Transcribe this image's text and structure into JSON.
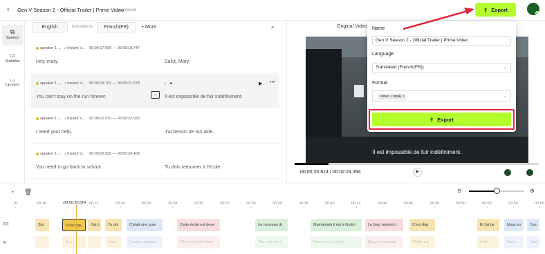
{
  "topbar": {
    "back_icon": "chevron-left-icon",
    "title": "Gen V Season 2 - Official Trailer | Prime Video",
    "saved": "Saved",
    "export_label": "Export",
    "help": "?"
  },
  "rail": {
    "items": [
      {
        "label": "Speech",
        "icon": "speech-icon"
      },
      {
        "label": "Subtitles",
        "icon": "subtitles-icon"
      },
      {
        "label": "Lip-sync",
        "icon": "lipsync-icon"
      }
    ]
  },
  "langbar": {
    "source": "English",
    "translate_to": "translate to",
    "target": "French(FR)",
    "more": "+ More"
  },
  "segments": [
    {
      "speaker": "speaker 1",
      "voice": "Instant V...",
      "start": "00:00:17.650",
      "end": "00:00:18.747",
      "src": "Hey, mary.",
      "tgt": "Salut, Mary."
    },
    {
      "speaker": "speaker 1",
      "voice": "Instant V...",
      "start": "00:00:19.701",
      "end": "00:00:21.578",
      "src": "You can't stay on the run forever.",
      "tgt": "Il est impossible de fuir indéfiniment."
    },
    {
      "speaker": "speaker 1",
      "voice": "Instant V...",
      "start": "00:00:21.570",
      "end": "00:00:22.920",
      "src": "I need your help.",
      "tgt": "J'ai besoin de ton aide."
    },
    {
      "speaker": "speaker 1",
      "voice": "Instant V...",
      "start": "00:00:22.920",
      "end": "00:00:24.409",
      "src": "You need to go back to school.",
      "tgt": "Tu dois retourner à l'école."
    }
  ],
  "preview": {
    "tab": "Original Video",
    "subtitle": "Il est impossible de fuir indéfiniment.",
    "time": "00:00:20.814 / 00:02:24.394",
    "progress": 0.14
  },
  "dialog": {
    "name_label": "Name",
    "name_value": "Gen V Season 2 - Official Trailer | Prime Video",
    "language_label": "Language",
    "language_value": "Translated (French(FR))",
    "format_label": "Format",
    "format_chip": "Video (.mp4)",
    "export_label": "Export"
  },
  "timeline": {
    "zoom": 0.5,
    "playhead_time": "00:00:20.814",
    "ticks": [
      "16",
      "00:18",
      "00:20",
      "00:22",
      "00:24",
      "00:26",
      "00:28",
      "00:30",
      "00:32",
      "00:34",
      "00:36",
      "00:38",
      "00:40",
      "00:42",
      "00:44",
      "00:46",
      "00:48",
      "00:50",
      "00:52",
      "00:54",
      "00:56"
    ],
    "fr_label": "FR",
    "fr_clips": [
      "Sal",
      "Il est imp...",
      "J'ai b",
      "Tu doi",
      "C'était une grav",
      "Cette école est deve",
      "Le nouveau di",
      "Maintenant il est à Godol",
      "Le blog reprend c",
      "C'est drig",
      "Et j'ai be",
      "Nous so",
      "Ces"
    ],
    "src_clips": [
      "",
      "Yo c",
      "I",
      "You i",
      "It was a mistake",
      "The school it's beco",
      "The new dear",
      "Now he's at Godol",
      "Blog is resuming",
      "That's a g",
      "And",
      "We're",
      "Thes"
    ]
  }
}
